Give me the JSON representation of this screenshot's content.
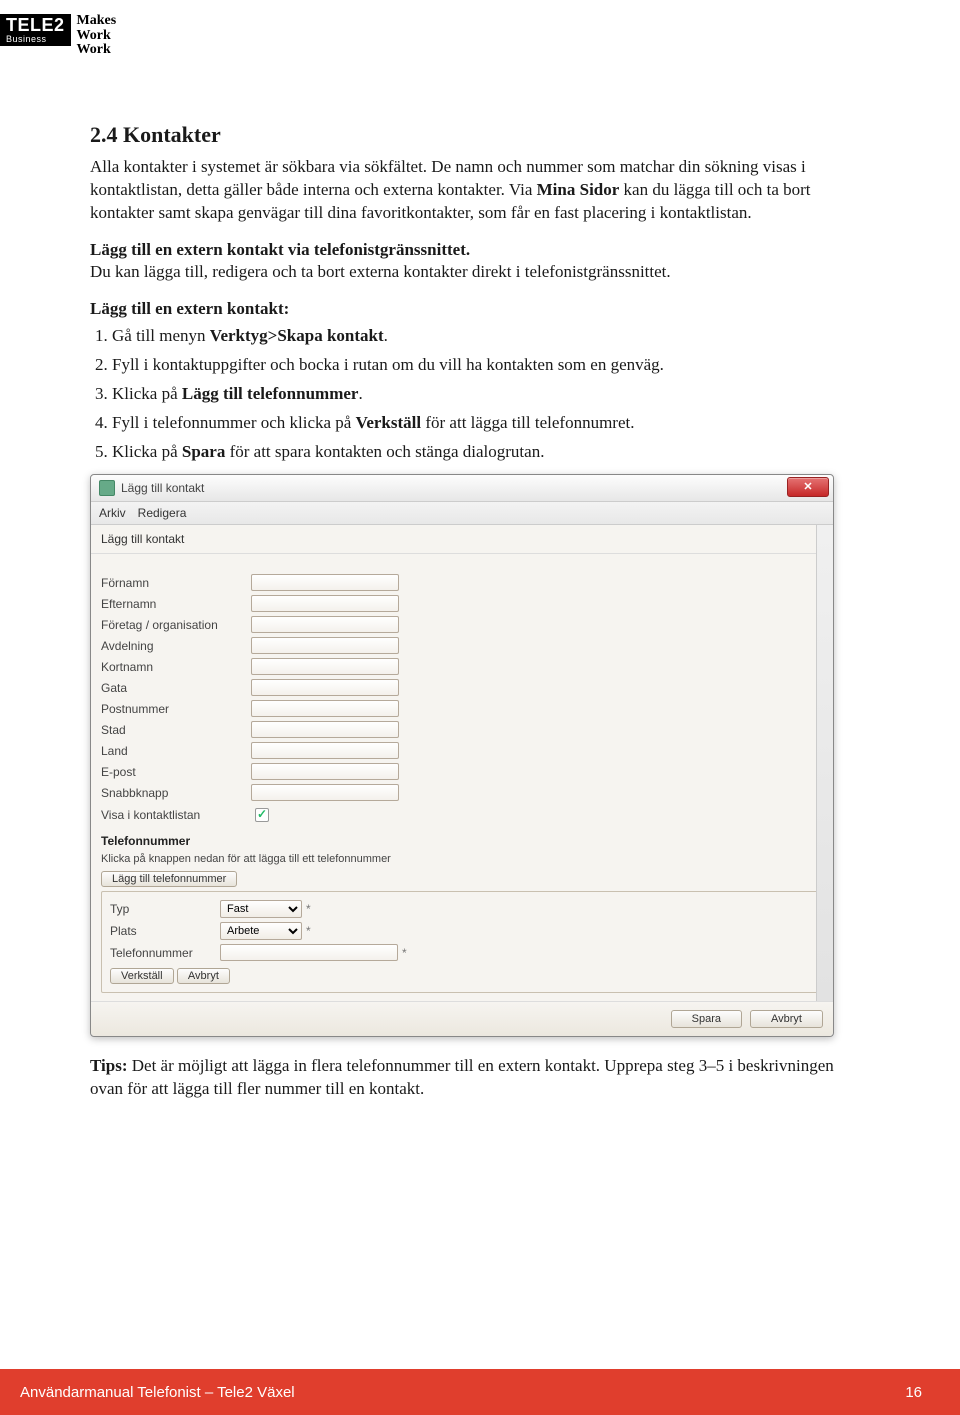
{
  "logo": {
    "brand": "TELE2",
    "brand_sub": "Business",
    "tagline_1": "Makes",
    "tagline_2": "Work",
    "tagline_3": "Work"
  },
  "section": {
    "heading": "2.4 Kontakter",
    "para1_a": "Alla kontakter i systemet är sökbara via sökfältet. De namn och nummer som matchar din sökning visas i kontaktlistan, detta gäller både interna och externa kontakter. Via ",
    "para1_b": "Mina Sidor",
    "para1_c": " kan du lägga till och ta bort kontakter samt skapa genvägar till dina favoritkontakter, som får en fast placering i kontaktlistan.",
    "para2_title": "Lägg till en extern kontakt via telefonistgränssnittet.",
    "para2_body": "Du kan lägga till, redigera och ta bort externa kontakter direkt i telefonistgränssnittet.",
    "list_title": "Lägg till en extern kontakt:",
    "steps": [
      {
        "pre": "Gå till menyn ",
        "bold": "Verktyg>Skapa kontakt",
        "post": "."
      },
      {
        "pre": "Fyll i kontaktuppgifter och bocka i rutan om du vill ha kontakten som en genväg.",
        "bold": "",
        "post": ""
      },
      {
        "pre": "Klicka på ",
        "bold": "Lägg till telefonnummer",
        "post": "."
      },
      {
        "pre": "Fyll i telefonnummer och klicka på ",
        "bold": "Verkställ",
        "post": " för att lägga till telefonnumret."
      },
      {
        "pre": "Klicka på ",
        "bold": "Spara",
        "post": " för att spara kontakten och stänga dialogrutan."
      }
    ],
    "tip_label": "Tips:",
    "tip_body": " Det är möjligt att lägga in flera telefonnummer till en extern kontakt. Upprepa steg 3–5 i beskrivningen ovan för att lägga till fler nummer till en kontakt."
  },
  "dialog": {
    "title": "Lägg till kontakt",
    "menu": {
      "arkiv": "Arkiv",
      "redigera": "Redigera"
    },
    "subtitle": "Lägg till kontakt",
    "fields": {
      "fornamn": "Förnamn",
      "efternamn": "Efternamn",
      "foretag": "Företag / organisation",
      "avdelning": "Avdelning",
      "kortnamn": "Kortnamn",
      "gata": "Gata",
      "postnummer": "Postnummer",
      "stad": "Stad",
      "land": "Land",
      "epost": "E-post",
      "snabbknapp": "Snabbknapp",
      "visa_i_kontaktlistan": "Visa i kontaktlistan"
    },
    "phone_section": {
      "title": "Telefonnummer",
      "hint": "Klicka på knappen nedan för att lägga till ett telefonnummer",
      "add_button": "Lägg till telefonnummer",
      "typ_label": "Typ",
      "typ_value": "Fast",
      "plats_label": "Plats",
      "plats_value": "Arbete",
      "telefonnummer_label": "Telefonnummer",
      "verkstall": "Verkställ",
      "avbryt": "Avbryt"
    },
    "footer": {
      "spara": "Spara",
      "avbryt": "Avbryt"
    }
  },
  "footer": {
    "doc": "Användarmanual Telefonist – Tele2 Växel",
    "page": "16"
  }
}
